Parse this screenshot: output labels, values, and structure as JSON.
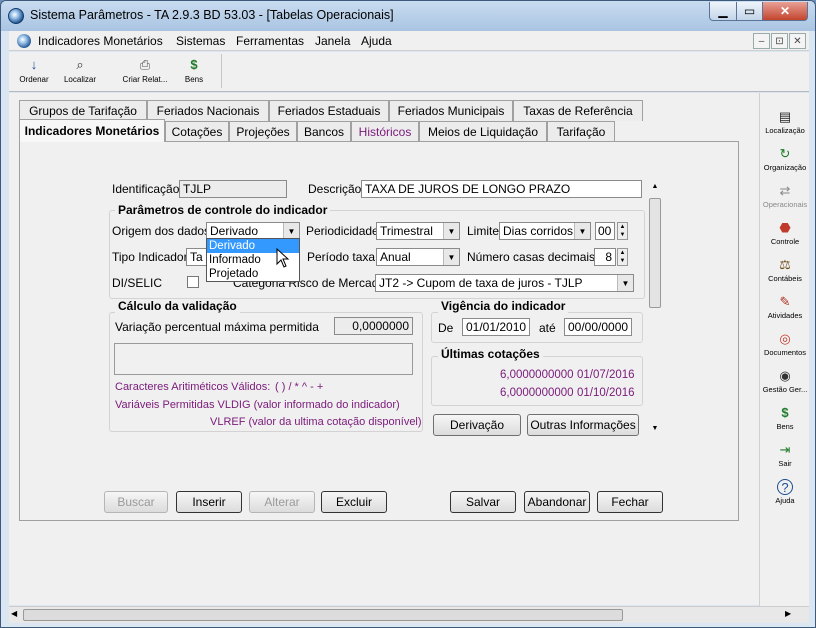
{
  "window": {
    "title": "Sistema Parâmetros -  TA 2.9.3 BD 53.03 - [Tabelas Operacionais]",
    "min_label": "▭",
    "max_label": "▣",
    "close_label": "✕"
  },
  "menu": {
    "items": [
      "Indicadores Monetários",
      "Sistemas",
      "Ferramentas",
      "Janela",
      "Ajuda"
    ],
    "mdi_min": "–",
    "mdi_restore": "⊡",
    "mdi_close": "✕"
  },
  "toolbar": {
    "items": [
      {
        "label": "Ordenar",
        "icon": "sort-az-icon",
        "glyph": "↓"
      },
      {
        "label": "Localizar",
        "icon": "binoculars-icon",
        "glyph": "⌕"
      },
      {
        "label": "Criar Relat...",
        "icon": "printer-icon",
        "glyph": "⎙"
      },
      {
        "label": "Bens",
        "icon": "money-bag-icon",
        "glyph": "$"
      }
    ]
  },
  "tabs_top": [
    "Grupos de Tarifação",
    "Feriados Nacionais",
    "Feriados Estaduais",
    "Feriados Municipais",
    "Taxas de Referência"
  ],
  "tabs_bottom": [
    "Indicadores Monetários",
    "Cotações",
    "Projeções",
    "Bancos",
    "Históricos",
    "Meios de Liquidação",
    "Tarifação"
  ],
  "form": {
    "identificacao_label": "Identificação",
    "identificacao_value": "TJLP",
    "descricao_label": "Descrição",
    "descricao_value": "TAXA DE JUROS DE LONGO PRAZO",
    "params_title": "Parâmetros de controle do indicador",
    "origem_label": "Origem dos dados",
    "origem_value": "Derivado",
    "periodicidade_label": "Periodicidade",
    "periodicidade_value": "Trimestral",
    "limite_label": "Limite",
    "limite_value": "Dias corridos",
    "limite_num": "00",
    "tipo_label": "Tipo Indicador",
    "tipo_value": "Ta",
    "periodo_label": "Período taxa",
    "periodo_value": "Anual",
    "casas_label": "Número casas decimais",
    "casas_value": "8",
    "diselic_label": "DI/SELIC",
    "categoria_label": "Categoria Risco de Mercado",
    "categoria_value": "JT2 -> Cupom de taxa de juros - TJLP",
    "dropdown_options": [
      "Derivado",
      "Informado",
      "Projetado"
    ]
  },
  "validacao": {
    "title": "Cálculo da validação",
    "variacao_label": "Variação percentual máxima permitida",
    "variacao_value": "0,0000000",
    "caracteres_label": "Caracteres Aritiméticos Válidos:",
    "caracteres_value": "( ) / * ^ - +",
    "variaveis_text": "Variáveis Permitidas VLDIG  (valor informado do indicador)",
    "vlref_text": "VLREF  (valor da ultima cotação disponível)"
  },
  "vigencia": {
    "title": "Vigência do indicador",
    "de_label": "De",
    "de_value": "01/01/2010",
    "ate_label": "até",
    "ate_value": "00/00/0000"
  },
  "cotacoes": {
    "title": "Últimas cotações",
    "rows": [
      {
        "value": "6,0000000000",
        "date": "01/07/2016"
      },
      {
        "value": "6,0000000000",
        "date": "01/10/2016"
      }
    ]
  },
  "buttons": {
    "derivacao": "Derivação",
    "outras": "Outras Informações",
    "buscar": "Buscar",
    "inserir": "Inserir",
    "alterar": "Alterar",
    "excluir": "Excluir",
    "salvar": "Salvar",
    "abandonar": "Abandonar",
    "fechar": "Fechar"
  },
  "rightbar": [
    {
      "label": "Localização",
      "icon": "document-icon",
      "glyph": "▤",
      "color": "#222222"
    },
    {
      "label": "Organização",
      "icon": "refresh-icon",
      "glyph": "↻",
      "color": "#1f7a2a"
    },
    {
      "label": "Operacionais",
      "icon": "handshake-icon",
      "glyph": "⇄",
      "color": "#888888"
    },
    {
      "label": "Controle",
      "icon": "stop-icon",
      "glyph": "⬣",
      "color": "#c0392b"
    },
    {
      "label": "Contábeis",
      "icon": "scale-icon",
      "glyph": "⚖",
      "color": "#6b4a1a"
    },
    {
      "label": "Atividades",
      "icon": "pin-icon",
      "glyph": "✎",
      "color": "#b03020"
    },
    {
      "label": "Documentos",
      "icon": "target-icon",
      "glyph": "◎",
      "color": "#c0392b"
    },
    {
      "label": "Gestão Ger...",
      "icon": "eye-icon",
      "glyph": "◉",
      "color": "#333333"
    },
    {
      "label": "Bens",
      "icon": "money-bag-icon",
      "glyph": "$",
      "color": "#1f7a2a"
    },
    {
      "label": "Sair",
      "icon": "exit-door-icon",
      "glyph": "⇥",
      "color": "#1f7a2a"
    },
    {
      "label": "Ajuda",
      "icon": "help-icon",
      "glyph": "?",
      "color": "#1c4f8f"
    }
  ]
}
